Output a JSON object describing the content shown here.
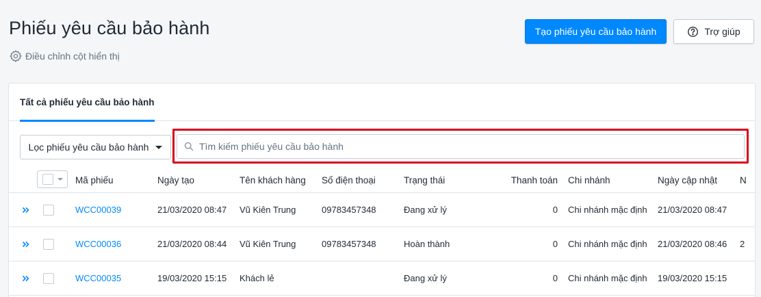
{
  "header": {
    "title": "Phiếu yêu cầu bảo hành",
    "adjust_columns": "Điều chỉnh cột hiển thị",
    "create_button": "Tạo phiếu yêu cầu bảo hành",
    "help_button": "Trợ giúp"
  },
  "tabs": [
    {
      "label": "Tất cả phiếu yêu cầu bảo hành",
      "active": true
    }
  ],
  "filter": {
    "label": "Lọc phiếu yêu cầu bảo hành"
  },
  "search": {
    "placeholder": "Tìm kiếm phiếu yêu cầu bảo hành",
    "value": ""
  },
  "table": {
    "columns": [
      "Mã phiếu",
      "Ngày tạo",
      "Tên khách hàng",
      "Số điện thoại",
      "Trạng thái",
      "Thanh toán",
      "Chi nhánh",
      "Ngày cập nhật",
      "N"
    ],
    "rows": [
      {
        "code": "WCC00039",
        "created": "21/03/2020 08:47",
        "customer": "Vũ Kiên Trung",
        "phone": "09783457348",
        "status": "Đang xử lý",
        "payment": "0",
        "branch": "Chi nhánh mặc định",
        "updated": "21/03/2020 08:47",
        "extra": ""
      },
      {
        "code": "WCC00036",
        "created": "21/03/2020 08:44",
        "customer": "Vũ Kiên Trung",
        "phone": "09783457348",
        "status": "Hoàn thành",
        "payment": "0",
        "branch": "Chi nhánh mặc định",
        "updated": "21/03/2020 08:46",
        "extra": "2"
      },
      {
        "code": "WCC00035",
        "created": "19/03/2020 15:15",
        "customer": "Khách lẻ",
        "phone": "",
        "status": "Đang xử lý",
        "payment": "0",
        "branch": "Chi nhánh mặc định",
        "updated": "19/03/2020 15:15",
        "extra": ""
      }
    ]
  },
  "colors": {
    "accent": "#0088ff",
    "highlight": "#d9001b"
  }
}
